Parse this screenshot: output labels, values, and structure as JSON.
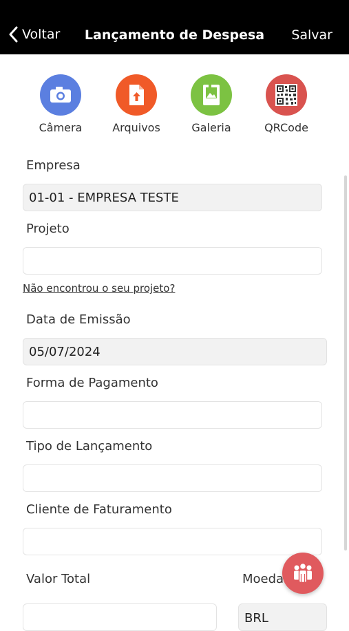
{
  "header": {
    "back_label": "Voltar",
    "title": "Lançamento de Despesa",
    "save_label": "Salvar"
  },
  "actions": [
    {
      "label": "Câmera",
      "icon": "camera-icon",
      "color": "#5b7fe0"
    },
    {
      "label": "Arquivos",
      "icon": "file-upload-icon",
      "color": "#f05a28"
    },
    {
      "label": "Galeria",
      "icon": "gallery-icon",
      "color": "#7cc242"
    },
    {
      "label": "QRCode",
      "icon": "qrcode-icon",
      "color": "#d9534f"
    }
  ],
  "form": {
    "empresa": {
      "label": "Empresa",
      "value": "01-01 - EMPRESA TESTE"
    },
    "projeto": {
      "label": "Projeto",
      "value": ""
    },
    "projeto_link": "Não encontrou o seu projeto?",
    "data_emissao": {
      "label": "Data de Emissão",
      "value": "05/07/2024"
    },
    "forma_pagamento": {
      "label": "Forma de Pagamento",
      "value": ""
    },
    "tipo_lancamento": {
      "label": "Tipo de Lançamento",
      "value": ""
    },
    "cliente_faturamento": {
      "label": "Cliente de Faturamento",
      "value": ""
    },
    "valor_total": {
      "label": "Valor Total",
      "value": ""
    },
    "moeda": {
      "label": "Moeda",
      "value": "BRL"
    }
  },
  "fab": {
    "icon": "team-icon",
    "color": "#e05a5e"
  }
}
